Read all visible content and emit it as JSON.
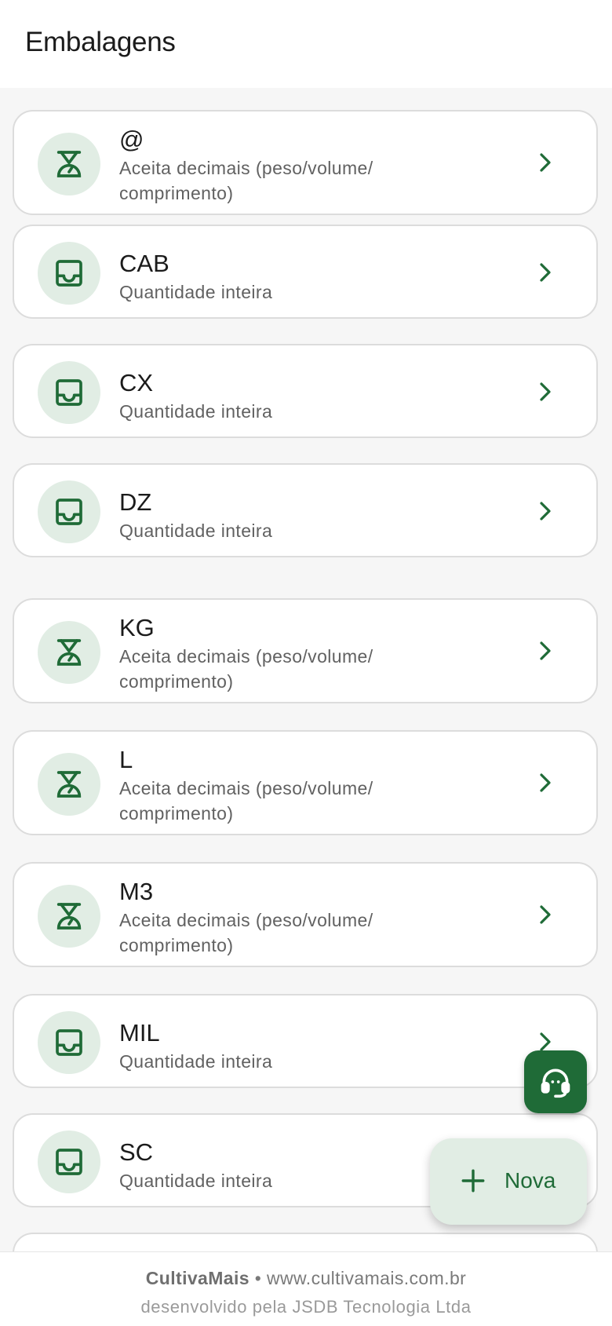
{
  "header": {
    "title": "Embalagens"
  },
  "packages": [
    {
      "code": "@",
      "description": "Aceita decimais (peso/volume/ comprimento)",
      "icon": "scale-icon"
    },
    {
      "code": "CAB",
      "description": "Quantidade inteira",
      "icon": "inbox-icon"
    },
    {
      "code": "CX",
      "description": "Quantidade inteira",
      "icon": "inbox-icon"
    },
    {
      "code": "DZ",
      "description": "Quantidade inteira",
      "icon": "inbox-icon"
    },
    {
      "code": "KG",
      "description": "Aceita decimais (peso/volume/ comprimento)",
      "icon": "scale-icon"
    },
    {
      "code": "L",
      "description": "Aceita decimais (peso/volume/ comprimento)",
      "icon": "scale-icon"
    },
    {
      "code": "M3",
      "description": "Aceita decimais (peso/volume/ comprimento)",
      "icon": "scale-icon"
    },
    {
      "code": "MIL",
      "description": "Quantidade inteira",
      "icon": "inbox-icon"
    },
    {
      "code": "SC",
      "description": "Quantidade inteira",
      "icon": "inbox-icon"
    }
  ],
  "fab_new": {
    "label": "Nova",
    "icon": "plus-icon"
  },
  "fab_support": {
    "icon": "headset-support-icon"
  },
  "footer": {
    "brand": "CultivaMais",
    "separator": "•",
    "url": "www.cultivamais.com.br",
    "credit": "desenvolvido pela JSDB Tecnologia Ltda"
  },
  "colors": {
    "primary": "#1f6b37",
    "icon_bg": "#e1ede4",
    "background": "#f6f6f6",
    "card_border": "#dcdcdc"
  }
}
